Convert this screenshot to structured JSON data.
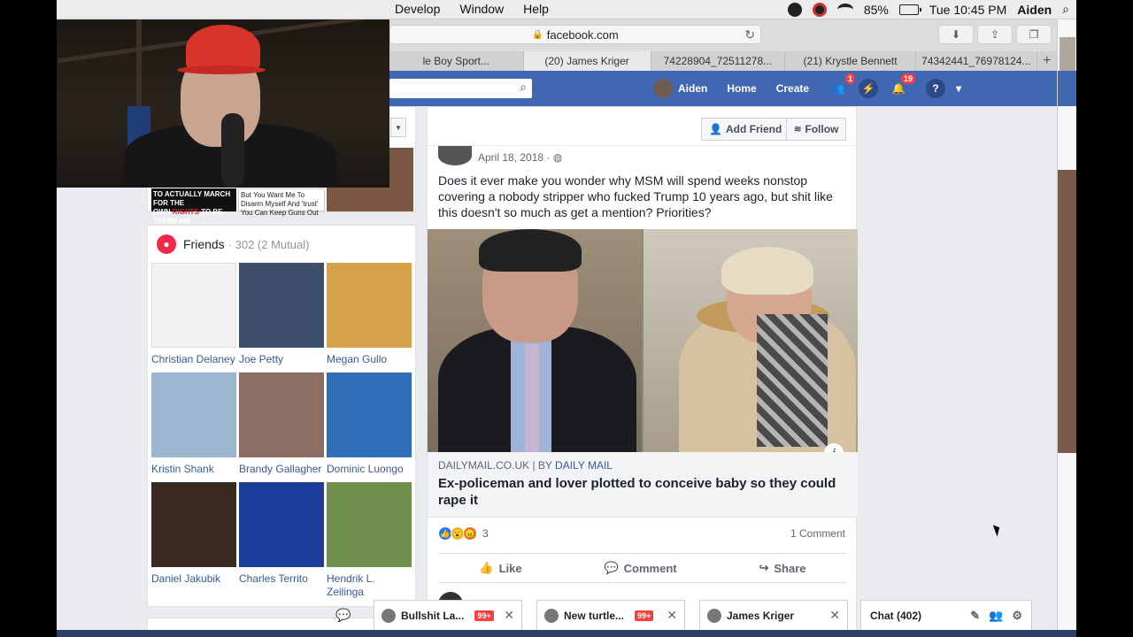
{
  "menubar": {
    "items": [
      "Develop",
      "Window",
      "Help"
    ],
    "battery": "85%",
    "clock": "Tue 10:45 PM",
    "user": "Aiden",
    "icons": [
      "dropbox-icon",
      "record-icon",
      "wifi-icon",
      "battery-icon",
      "search-icon"
    ]
  },
  "browser": {
    "url": "facebook.com",
    "tabs": [
      {
        "label": "le Boy Sport...",
        "active": false
      },
      {
        "label": "(20) James Kriger",
        "active": true
      },
      {
        "label": "74228904_72511278...",
        "active": false
      },
      {
        "label": "(21) Krystle Bennett",
        "active": false
      },
      {
        "label": "74342441_76978124...",
        "active": false
      }
    ],
    "new_tab": "+"
  },
  "fbbar": {
    "user": "Aiden",
    "home": "Home",
    "create": "Create",
    "friend_requests_badge": "1",
    "notifications_badge": "19",
    "help": "?",
    "more": "▾"
  },
  "intro": {
    "meme_left_line1": "TO ACTUALLY MARCH FOR THE",
    "meme_left_line2_red": "RIGHTS",
    "meme_left_line2_pre": "OWN ",
    "meme_left_line2_post": " TO BE TAKEN AW",
    "meme_right_line1": "But You Want Me To",
    "meme_right_line2": "Disarm Myself And 'trust'",
    "meme_right_line3": "You Can Keep Guns Out"
  },
  "friends": {
    "title": "Friends",
    "count": "· 302 (2 Mutual)",
    "list": [
      {
        "name": "Christian Delaney",
        "color": "#f2f2f2"
      },
      {
        "name": "Joe Petty",
        "color": "#3d4f6b"
      },
      {
        "name": "Megan Gullo",
        "color": "#d7a34a"
      },
      {
        "name": "Kristin Shank",
        "color": "#9db6cf"
      },
      {
        "name": "Brandy Gallagher",
        "color": "#8d6e63"
      },
      {
        "name": "Dominic Luongo",
        "color": "#2f6fb8"
      },
      {
        "name": "Daniel Jakubik",
        "color": "#3a2a20"
      },
      {
        "name": "Charles Territo",
        "color": "#1d3d9a"
      },
      {
        "name": "Hendrik L. Zeilinga",
        "color": "#6f8f4c"
      }
    ]
  },
  "post": {
    "add_friend": "Add Friend",
    "follow": "Follow",
    "date": "April 18, 2018 ·",
    "text": "Does it ever make you wonder why MSM will spend weeks nonstop covering a nobody stripper who fucked Trump 10 years ago, but shit like this doesn't so much as get a mention? Priorities?",
    "link_source_pre": "DAILYMAIL.CO.UK | BY ",
    "link_source_name": "DAILY MAIL",
    "link_title": "Ex-policeman and lover plotted to conceive baby so they could rape it",
    "reaction_count": "3",
    "comments": "1 Comment",
    "like": "Like",
    "comment": "Comment",
    "share": "Share",
    "info": "i"
  },
  "chat": {
    "tabs": [
      {
        "label": "Bullshit La...",
        "badge": "99+"
      },
      {
        "label": "New turtle...",
        "badge": "99+"
      },
      {
        "label": "James Kriger",
        "badge": ""
      }
    ],
    "main_label": "Chat (402)",
    "close": "✕"
  },
  "colors": {
    "fb_blue": "#4267b2",
    "link_blue": "#385898",
    "badge_red": "#fa3e3e"
  }
}
